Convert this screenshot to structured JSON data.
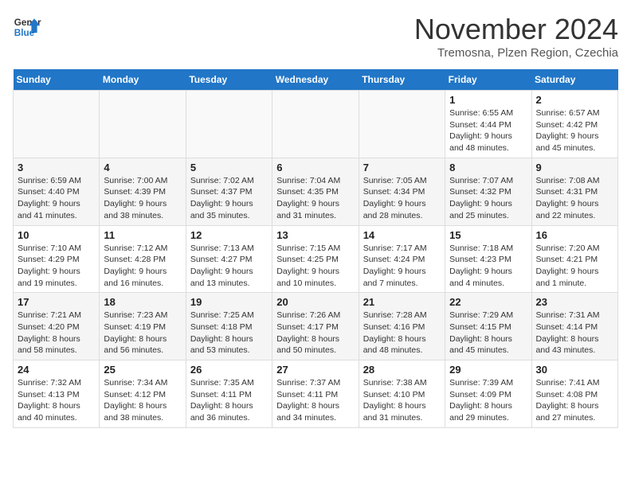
{
  "header": {
    "logo_line1": "General",
    "logo_line2": "Blue",
    "month_title": "November 2024",
    "location": "Tremosna, Plzen Region, Czechia"
  },
  "days_of_week": [
    "Sunday",
    "Monday",
    "Tuesday",
    "Wednesday",
    "Thursday",
    "Friday",
    "Saturday"
  ],
  "weeks": [
    [
      {
        "day": "",
        "details": ""
      },
      {
        "day": "",
        "details": ""
      },
      {
        "day": "",
        "details": ""
      },
      {
        "day": "",
        "details": ""
      },
      {
        "day": "",
        "details": ""
      },
      {
        "day": "1",
        "details": "Sunrise: 6:55 AM\nSunset: 4:44 PM\nDaylight: 9 hours\nand 48 minutes."
      },
      {
        "day": "2",
        "details": "Sunrise: 6:57 AM\nSunset: 4:42 PM\nDaylight: 9 hours\nand 45 minutes."
      }
    ],
    [
      {
        "day": "3",
        "details": "Sunrise: 6:59 AM\nSunset: 4:40 PM\nDaylight: 9 hours\nand 41 minutes."
      },
      {
        "day": "4",
        "details": "Sunrise: 7:00 AM\nSunset: 4:39 PM\nDaylight: 9 hours\nand 38 minutes."
      },
      {
        "day": "5",
        "details": "Sunrise: 7:02 AM\nSunset: 4:37 PM\nDaylight: 9 hours\nand 35 minutes."
      },
      {
        "day": "6",
        "details": "Sunrise: 7:04 AM\nSunset: 4:35 PM\nDaylight: 9 hours\nand 31 minutes."
      },
      {
        "day": "7",
        "details": "Sunrise: 7:05 AM\nSunset: 4:34 PM\nDaylight: 9 hours\nand 28 minutes."
      },
      {
        "day": "8",
        "details": "Sunrise: 7:07 AM\nSunset: 4:32 PM\nDaylight: 9 hours\nand 25 minutes."
      },
      {
        "day": "9",
        "details": "Sunrise: 7:08 AM\nSunset: 4:31 PM\nDaylight: 9 hours\nand 22 minutes."
      }
    ],
    [
      {
        "day": "10",
        "details": "Sunrise: 7:10 AM\nSunset: 4:29 PM\nDaylight: 9 hours\nand 19 minutes."
      },
      {
        "day": "11",
        "details": "Sunrise: 7:12 AM\nSunset: 4:28 PM\nDaylight: 9 hours\nand 16 minutes."
      },
      {
        "day": "12",
        "details": "Sunrise: 7:13 AM\nSunset: 4:27 PM\nDaylight: 9 hours\nand 13 minutes."
      },
      {
        "day": "13",
        "details": "Sunrise: 7:15 AM\nSunset: 4:25 PM\nDaylight: 9 hours\nand 10 minutes."
      },
      {
        "day": "14",
        "details": "Sunrise: 7:17 AM\nSunset: 4:24 PM\nDaylight: 9 hours\nand 7 minutes."
      },
      {
        "day": "15",
        "details": "Sunrise: 7:18 AM\nSunset: 4:23 PM\nDaylight: 9 hours\nand 4 minutes."
      },
      {
        "day": "16",
        "details": "Sunrise: 7:20 AM\nSunset: 4:21 PM\nDaylight: 9 hours\nand 1 minute."
      }
    ],
    [
      {
        "day": "17",
        "details": "Sunrise: 7:21 AM\nSunset: 4:20 PM\nDaylight: 8 hours\nand 58 minutes."
      },
      {
        "day": "18",
        "details": "Sunrise: 7:23 AM\nSunset: 4:19 PM\nDaylight: 8 hours\nand 56 minutes."
      },
      {
        "day": "19",
        "details": "Sunrise: 7:25 AM\nSunset: 4:18 PM\nDaylight: 8 hours\nand 53 minutes."
      },
      {
        "day": "20",
        "details": "Sunrise: 7:26 AM\nSunset: 4:17 PM\nDaylight: 8 hours\nand 50 minutes."
      },
      {
        "day": "21",
        "details": "Sunrise: 7:28 AM\nSunset: 4:16 PM\nDaylight: 8 hours\nand 48 minutes."
      },
      {
        "day": "22",
        "details": "Sunrise: 7:29 AM\nSunset: 4:15 PM\nDaylight: 8 hours\nand 45 minutes."
      },
      {
        "day": "23",
        "details": "Sunrise: 7:31 AM\nSunset: 4:14 PM\nDaylight: 8 hours\nand 43 minutes."
      }
    ],
    [
      {
        "day": "24",
        "details": "Sunrise: 7:32 AM\nSunset: 4:13 PM\nDaylight: 8 hours\nand 40 minutes."
      },
      {
        "day": "25",
        "details": "Sunrise: 7:34 AM\nSunset: 4:12 PM\nDaylight: 8 hours\nand 38 minutes."
      },
      {
        "day": "26",
        "details": "Sunrise: 7:35 AM\nSunset: 4:11 PM\nDaylight: 8 hours\nand 36 minutes."
      },
      {
        "day": "27",
        "details": "Sunrise: 7:37 AM\nSunset: 4:11 PM\nDaylight: 8 hours\nand 34 minutes."
      },
      {
        "day": "28",
        "details": "Sunrise: 7:38 AM\nSunset: 4:10 PM\nDaylight: 8 hours\nand 31 minutes."
      },
      {
        "day": "29",
        "details": "Sunrise: 7:39 AM\nSunset: 4:09 PM\nDaylight: 8 hours\nand 29 minutes."
      },
      {
        "day": "30",
        "details": "Sunrise: 7:41 AM\nSunset: 4:08 PM\nDaylight: 8 hours\nand 27 minutes."
      }
    ]
  ]
}
